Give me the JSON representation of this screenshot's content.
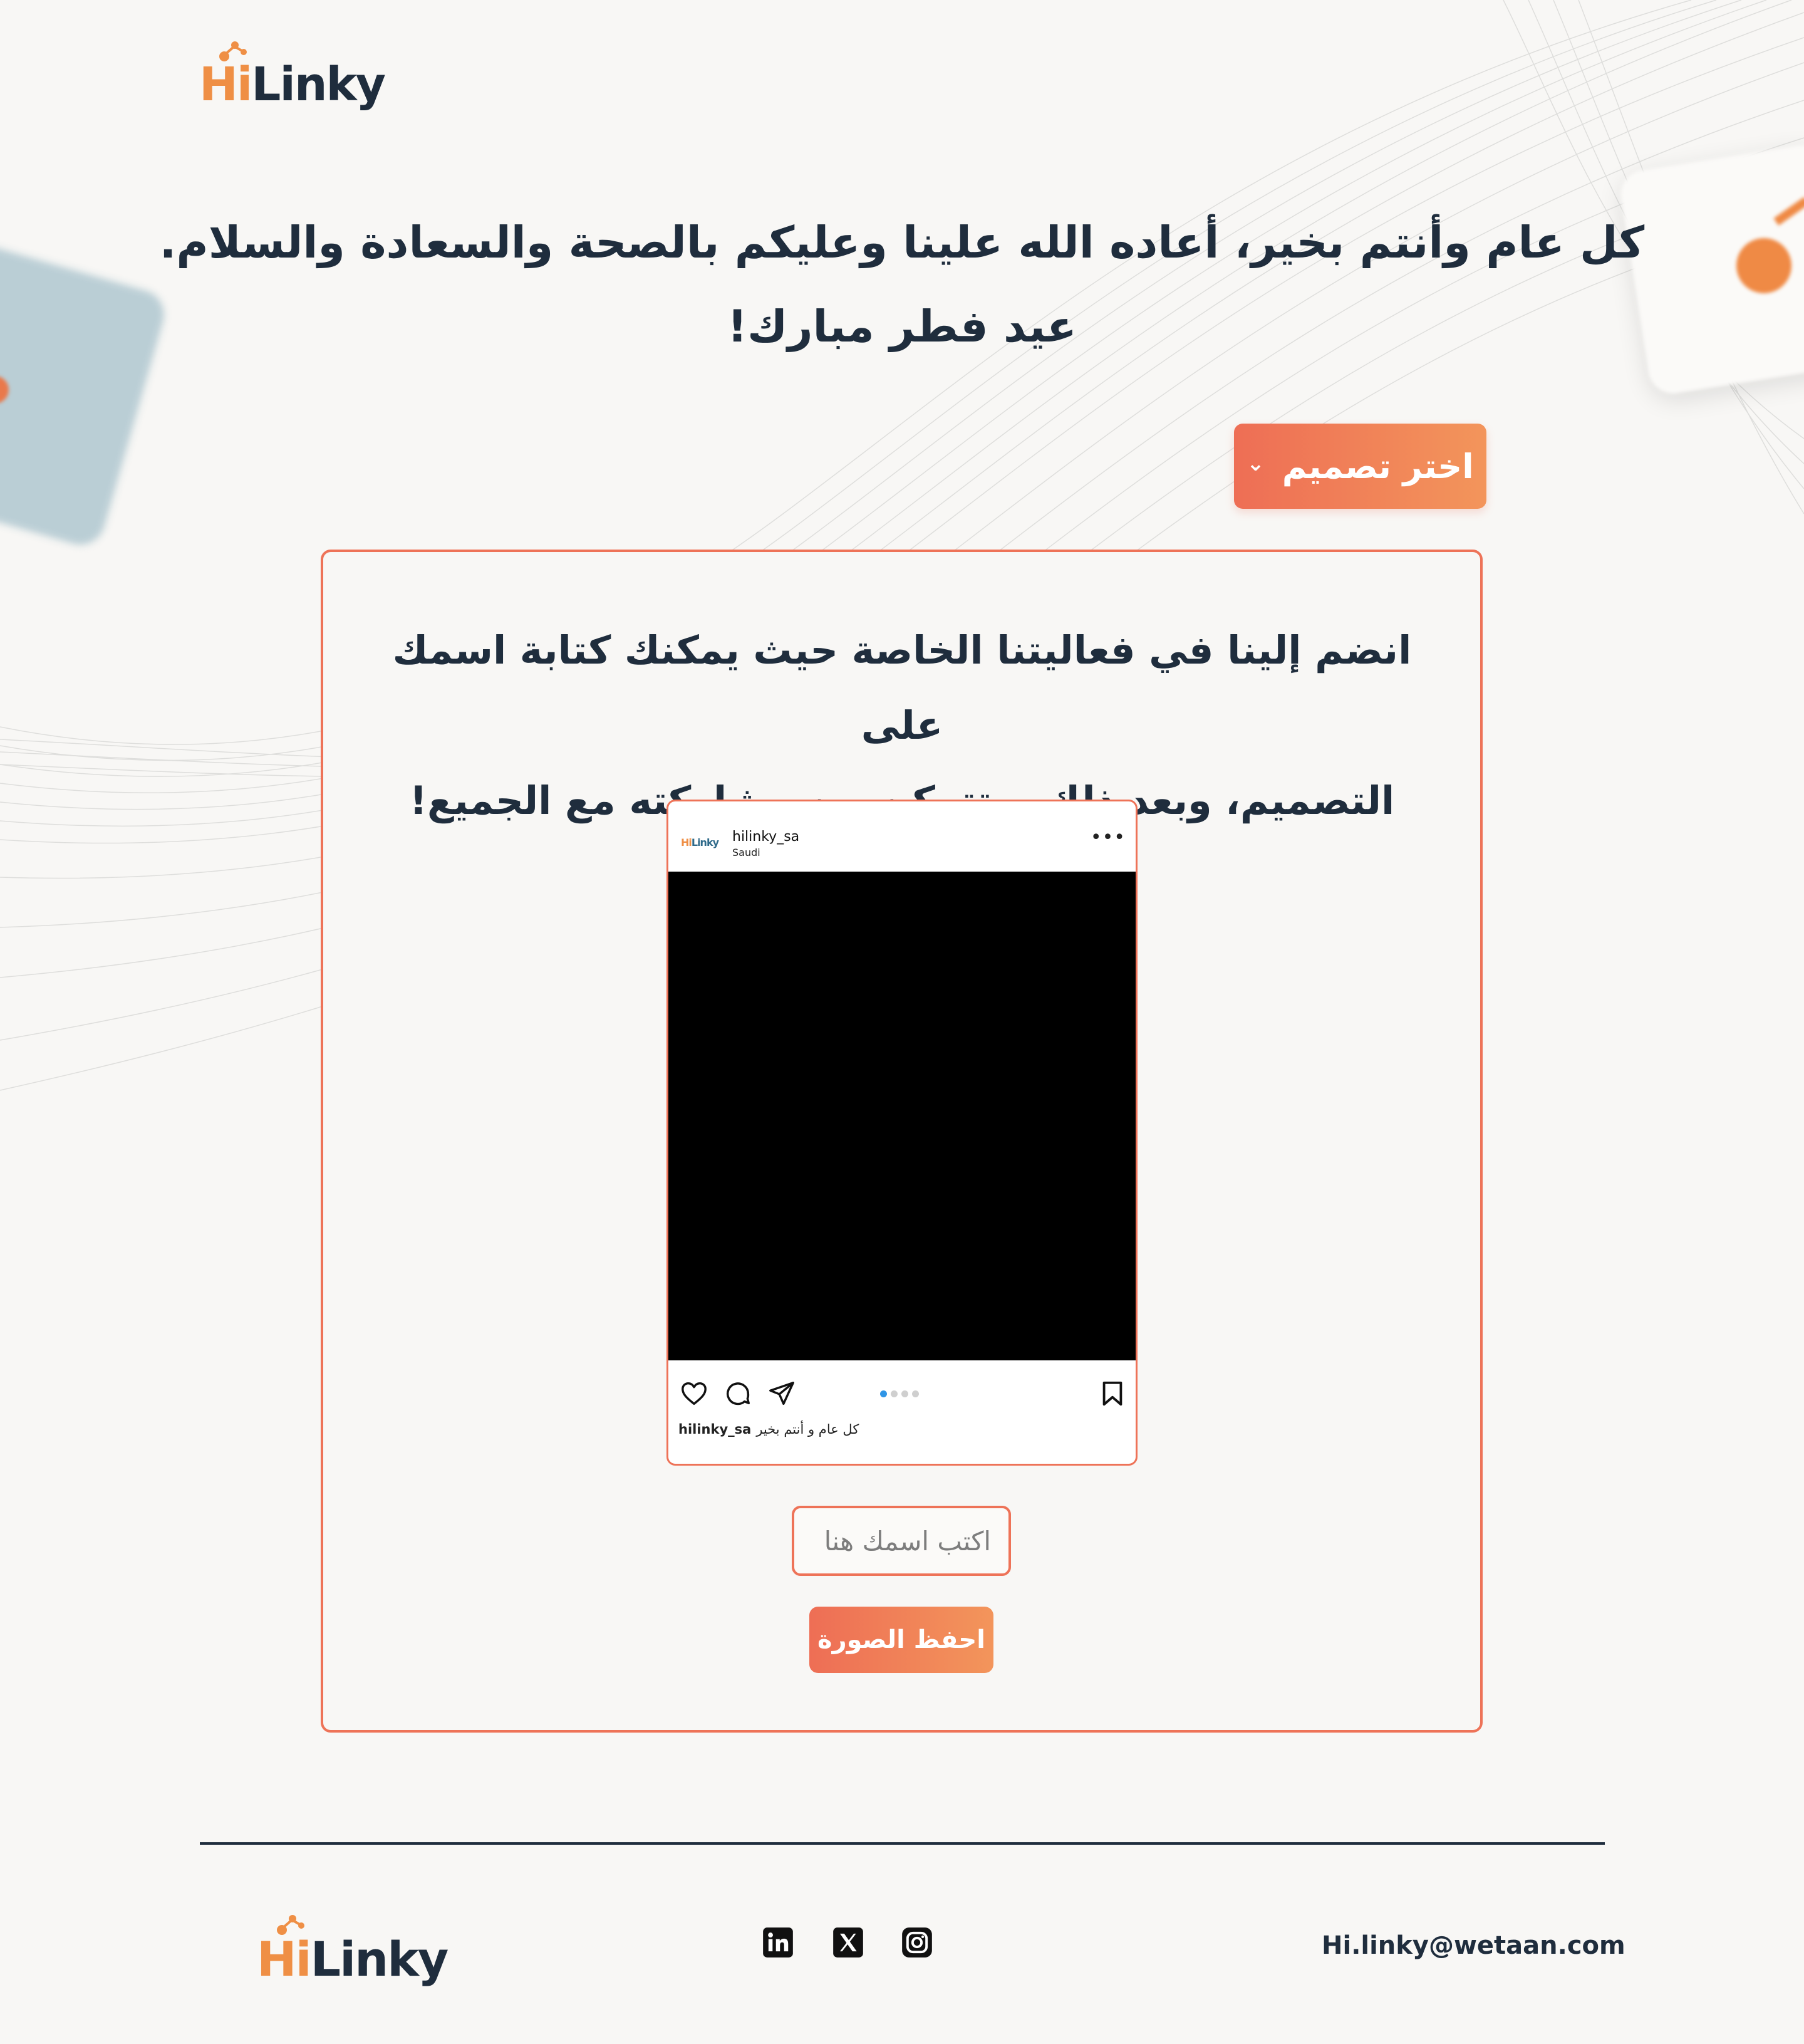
{
  "brand": {
    "logo_hi": "Hi",
    "logo_linky": "Linky"
  },
  "hero": {
    "line1": "كل عام وأنتم بخير، أعاده الله علينا وعليكم بالصحة والسعادة والسلام.",
    "line2": "عيد فطر مبارك!"
  },
  "design_select": {
    "label": "اختر تصميم",
    "icon": "chevron-down-icon"
  },
  "card": {
    "text_line1": "انضم إلينا في فعاليتنا الخاصة حيث يمكنك كتابة اسمك على",
    "text_line2": "التصميم، وبعد ذلك ستتمكن من مشاركته مع الجميع!"
  },
  "post": {
    "username": "hilinky_sa",
    "location": "Saudi",
    "more": "•••",
    "avatar_hi": "Hi",
    "avatar_linky": "Linky",
    "caption_user": "hilinky_sa",
    "caption_text": "كل عام و أنتم بخير",
    "carousel_total": 4,
    "carousel_active": 1,
    "icons": [
      "heart-icon",
      "comment-icon",
      "share-icon",
      "bookmark-icon"
    ]
  },
  "name_input": {
    "placeholder": "اكتب اسمك هنا",
    "value": ""
  },
  "save_button": {
    "label": "احفظ الصورة"
  },
  "footer": {
    "email": "Hi.linky@wetaan.com",
    "social": [
      "linkedin-icon",
      "x-icon",
      "instagram-icon"
    ]
  },
  "colors": {
    "accent_start": "#ee6e55",
    "accent_end": "#f3955b",
    "text_dark": "#1f2d3d",
    "logo_orange": "#ef8f45",
    "background": "#f8f7f5"
  }
}
